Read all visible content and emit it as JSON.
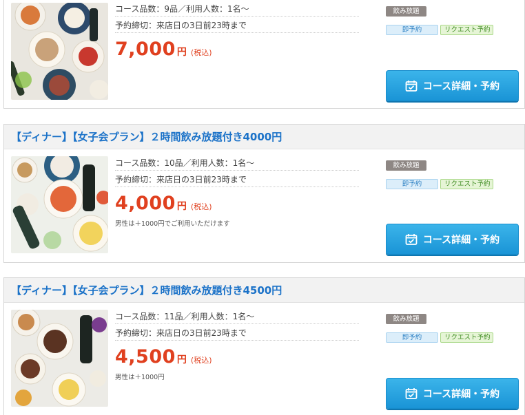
{
  "courses": [
    {
      "title": "",
      "items_label": "コース品数：9品／利用人数：1名〜",
      "deadline": "予約締切：来店日の3日前23時まで",
      "price": "7,000",
      "price_unit": "円",
      "tax_label": "(税込)",
      "note": "",
      "tags": {
        "nomihodai": "飲み放題",
        "instant": "即予約",
        "request": "リクエスト予約"
      },
      "button_label": "コース詳細・予約"
    },
    {
      "title": "【ディナー】【女子会プラン】２時間飲み放題付き4000円",
      "items_label": "コース品数：10品／利用人数：1名〜",
      "deadline": "予約締切：来店日の3日前23時まで",
      "price": "4,000",
      "price_unit": "円",
      "tax_label": "(税込)",
      "note": "男性は＋1000円でご利用いただけます",
      "tags": {
        "nomihodai": "飲み放題",
        "instant": "即予約",
        "request": "リクエスト予約"
      },
      "button_label": "コース詳細・予約"
    },
    {
      "title": "【ディナー】【女子会プラン】２時間飲み放題付き4500円",
      "items_label": "コース品数：11品／利用人数：1名〜",
      "deadline": "予約締切：来店日の3日前23時まで",
      "price": "4,500",
      "price_unit": "円",
      "tax_label": "(税込)",
      "note": "男性は＋1000円",
      "tags": {
        "nomihodai": "飲み放題",
        "instant": "即予約",
        "request": "リクエスト予約"
      },
      "button_label": "コース詳細・予約"
    }
  ],
  "colors": {
    "title": "#1b72c8",
    "price": "#e0401f",
    "button": "#1fa0dc",
    "tag_nomihodai": "#8e8784",
    "tag_instant": "#dceefa",
    "tag_request": "#e6f5d6"
  },
  "icons": {
    "button_icon": "calendar-check-icon",
    "photo": "course-food-photo"
  }
}
